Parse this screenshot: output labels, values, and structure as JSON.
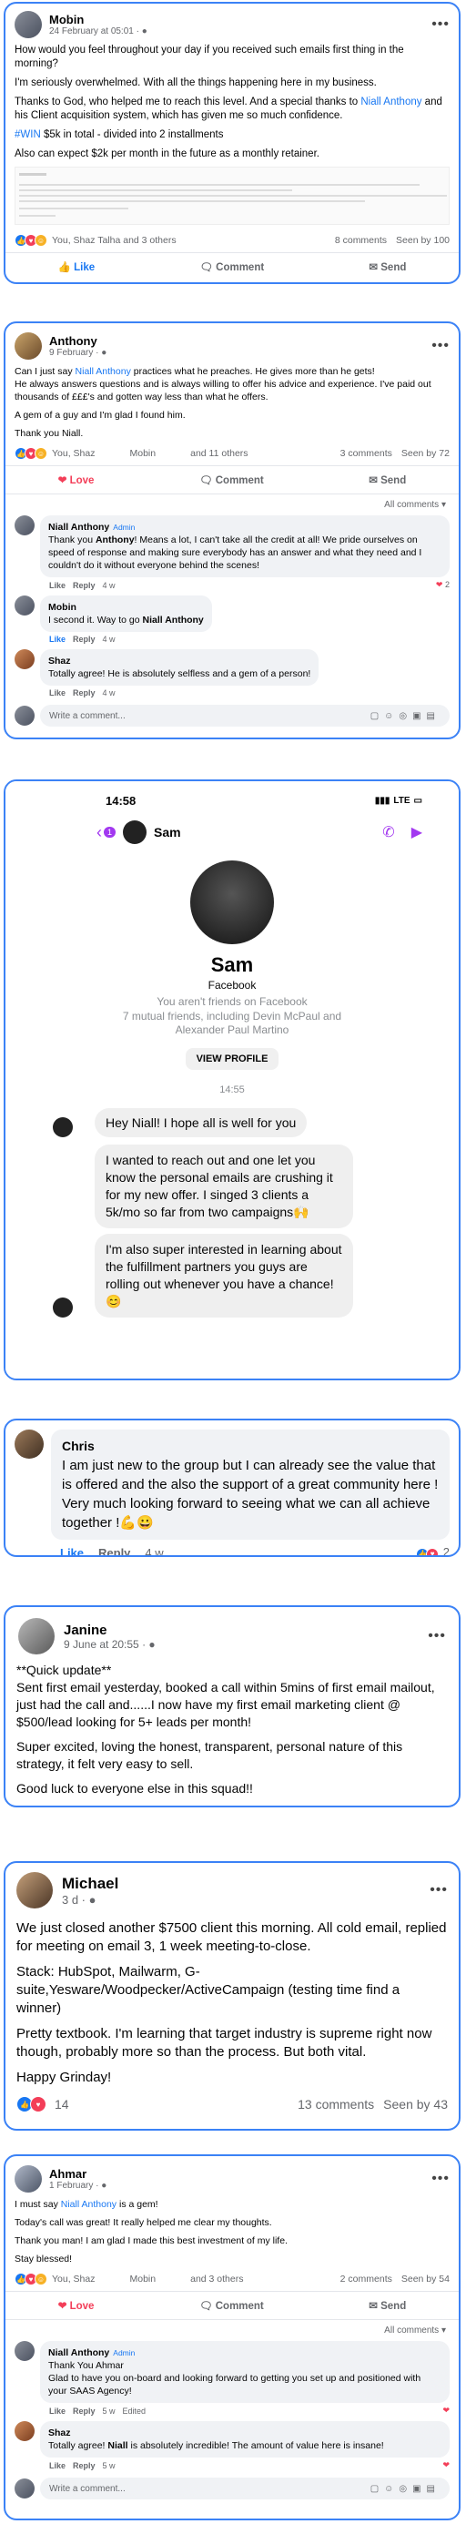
{
  "post1": {
    "author": "Mobin",
    "date": "24 February at 05:01 · ",
    "lines": [
      "How would you feel throughout your day if you received such emails first thing in the morning?",
      "I'm seriously overwhelmed. With all the things happening here in my business."
    ],
    "thanks_pre": " Thanks to God, who helped me to reach this level. And a special thanks to ",
    "mention": "Niall Anthony",
    "thanks_post": " and his Client acquisition system, which has given me so much confidence.",
    "hashtag": "#WIN",
    "win_text": " $5k  in total - divided into 2 installments",
    "retainer": "Also can expect $2k per month in the future as a monthly retainer.",
    "reactors": "You, Shaz Talha and 3 others",
    "comments": "8 comments",
    "seen": "Seen by 100",
    "like": "Like",
    "comment": "Comment",
    "send": "Send"
  },
  "post2": {
    "author": "Anthony",
    "date": "9 February · ",
    "l1_pre": "Can I just say ",
    "mention": "Niall Anthony",
    "l1_post": " practices what he preaches. He gives more than he gets!",
    "l2": "He always answers questions and is always willing to offer his advice and experience. I've paid out thousands of £££'s and gotten way less than  what he offers.",
    "l3": "A gem of a guy and I'm glad I found him.",
    "l4": "Thank you Niall.",
    "r1": "You, Shaz",
    "r2": "Mobin",
    "r3": "and 11 others",
    "comments": "3 comments",
    "seen": "Seen by 72",
    "love": "Love",
    "comment": "Comment",
    "send": "Send",
    "all_comments": "All comments",
    "c1_name": "Niall Anthony",
    "c1_badge": "Admin",
    "c1_pre": "Thank you ",
    "c1_bold": "Anthony",
    "c1_text": "! Means a lot, I can't take all the credit at all! We pride ourselves on speed of response and making sure everybody has an answer and what they need and I couldn't do it without everyone behind the scenes!",
    "c1_count": "2",
    "c1_time": "4 w",
    "c2_name": "Mobin",
    "c2_pre": "I second it. Way to go ",
    "c2_bold": "Niall Anthony",
    "c2_time": "4 w",
    "c3_name": "Shaz",
    "c3_text": "Totally agree! He is absolutely selfless and a gem of a person!",
    "c3_time": "4 w",
    "like": "Like",
    "reply": "Reply",
    "write": "Write a comment..."
  },
  "messenger": {
    "time": "14:58",
    "carrier": "LTE",
    "chat_name": "Sam",
    "back_count": "1",
    "profile_name": "Sam",
    "platform": "Facebook",
    "not_friends": "You aren't friends on Facebook",
    "mutual": "7 mutual friends, including Devin McPaul and Alexander Paul Martino",
    "view_profile": "VIEW PROFILE",
    "stamp": "14:55",
    "m1": "Hey Niall! I hope all is well for you",
    "m2": "I wanted to reach out and one let you know the personal emails are crushing it for my new offer. I singed 3 clients a 5k/mo so far from two campaigns🙌",
    "m3": "I'm also super interested in learning about the fulfillment partners you guys are rolling out whenever you have a chance! 😊"
  },
  "chris": {
    "name": "Chris",
    "text": "I am just new to the group but I can already see the value that is offered and the also the support of a great community here ! Very much looking forward to seeing what we can all achieve together !💪😀",
    "like": "Like",
    "reply": "Reply",
    "time": "4 w",
    "count": "2"
  },
  "janine": {
    "name": "Janine",
    "date": "9 June at 20:55 · ",
    "p1": "**Quick update**",
    "p2": "Sent first email yesterday, booked a call within 5mins of first email mailout, just had the call and......I now have my first email marketing client @ $500/lead looking for 5+ leads per month!",
    "p3": "Super excited, loving the honest, transparent, personal nature of this strategy, it felt very easy to sell.",
    "p4": "Good luck to everyone else in this squad!!"
  },
  "michael": {
    "name": "Michael",
    "date": "3 d · ",
    "p1": "We just closed another $7500 client this morning. All cold email, replied for meeting on email 3, 1 week meeting-to-close.",
    "p2": "Stack: HubSpot, Mailwarm, G-suite,Yesware/Woodpecker/ActiveCampaign (testing time find a winner)",
    "p3": "Pretty textbook. I'm learning that target industry is supreme right now though, probably more so than the process. But both vital.",
    "p4": "Happy Grinday!",
    "count": "14",
    "comments": "13 comments",
    "seen": "Seen by 43"
  },
  "ahmar": {
    "name": "Ahmar",
    "date": "1 February · ",
    "l1_pre": "I must say ",
    "mention": "Niall Anthony",
    "l1_post": " is a gem!",
    "l2": "Today's call was great! It really helped me clear my thoughts.",
    "l3": "Thank you man! I am glad I made this best investment of my life.",
    "l4": "Stay blessed!",
    "r1": "You, Shaz",
    "r2": "Mobin",
    "r3": "and 3 others",
    "comments": "2 comments",
    "seen": "Seen by 54",
    "love": "Love",
    "comment": "Comment",
    "send": "Send",
    "all_comments": "All comments",
    "c1_name": "Niall Anthony",
    "c1_badge": "Admin",
    "c1_l1": "Thank You Ahmar",
    "c1_l2": "Glad to have you on-board and looking forward to getting you set up and positioned with your SAAS Agency!",
    "c1_time": "5 w",
    "c1_edited": "Edited",
    "c2_name": "Shaz",
    "c2_pre": "Totally agree! ",
    "c2_bold": "Niall",
    "c2_post": " is absolutely incredible! The amount of value here is insane!",
    "c2_time": "5 w",
    "like": "Like",
    "reply": "Reply",
    "write": "Write a comment..."
  }
}
